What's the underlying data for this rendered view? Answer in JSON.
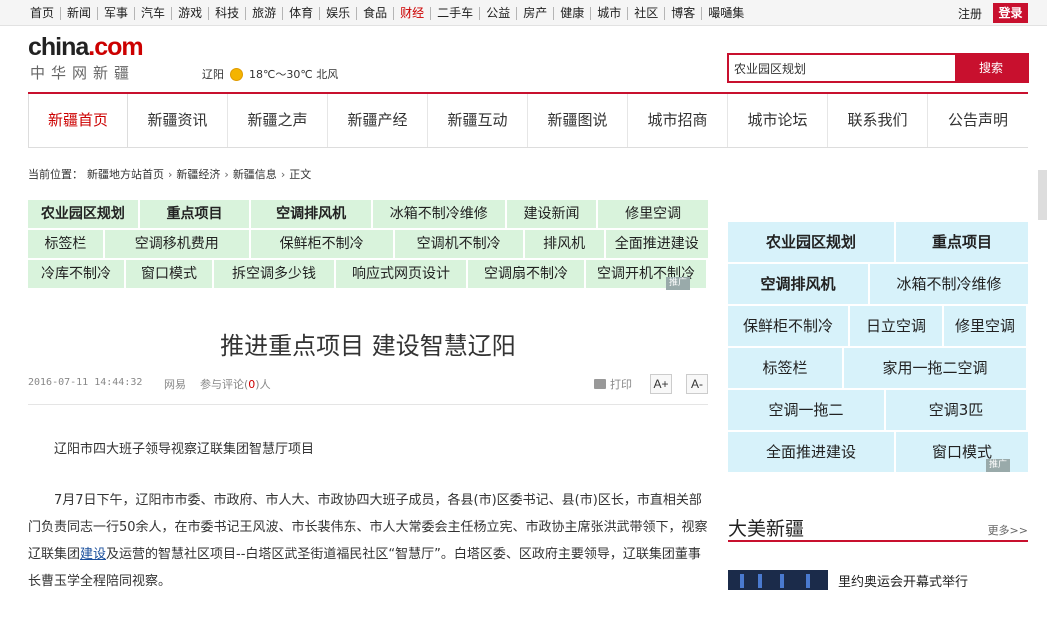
{
  "topnav": [
    "首页",
    "新闻",
    "军事",
    "汽车",
    "游戏",
    "科技",
    "旅游",
    "体育",
    "娱乐",
    "食品",
    "财经",
    "二手车",
    "公益",
    "房产",
    "健康",
    "城市",
    "社区",
    "博客",
    "嘬嗵集"
  ],
  "topnav_active": "财经",
  "register": "注册",
  "login": "登录",
  "logo": {
    "pre": "china",
    "dot": ".com",
    "cn": "中华网新疆"
  },
  "weather": {
    "city": "辽阳",
    "icon": "sun-icon",
    "text": "18℃～30℃ 北风"
  },
  "search": {
    "value": "农业园区规划",
    "button": "搜索"
  },
  "mainnav": [
    "新疆首页",
    "新疆资讯",
    "新疆之声",
    "新疆产经",
    "新疆互动",
    "新疆图说",
    "城市招商",
    "城市论坛",
    "联系我们",
    "公告声明"
  ],
  "breadcrumb": {
    "label": "当前位置：",
    "items": [
      "新疆地方站首页",
      "新疆经济",
      "新疆信息",
      "正文"
    ],
    "sep": "›"
  },
  "tags_left": [
    [
      {
        "t": "农业园区规划",
        "b": true,
        "w": 110
      },
      {
        "t": "重点项目",
        "b": true,
        "w": 110
      },
      {
        "t": "空调排风机",
        "b": true,
        "w": 120
      },
      {
        "t": "冰箱不制冷维修",
        "w": 132
      },
      {
        "t": "建设新闻",
        "w": 90
      },
      {
        "t": "修里空调",
        "w": 110
      }
    ],
    [
      {
        "t": "标签栏",
        "w": 76
      },
      {
        "t": "空调移机费用",
        "w": 146
      },
      {
        "t": "保鲜柜不制冷",
        "w": 144
      },
      {
        "t": "空调机不制冷",
        "w": 130
      },
      {
        "t": "排风机",
        "w": 80
      },
      {
        "t": "全面推进建设",
        "w": 104
      }
    ],
    [
      {
        "t": "冷库不制冷",
        "w": 96
      },
      {
        "t": "窗口模式",
        "w": 86
      },
      {
        "t": "拆空调多少钱",
        "w": 120
      },
      {
        "t": "响应式网页设计",
        "w": 130
      },
      {
        "t": "空调扇不制冷",
        "w": 116
      },
      {
        "t": "空调开机不制冷",
        "w": 120
      }
    ]
  ],
  "tags_right": [
    [
      {
        "t": "农业园区规划",
        "b": true,
        "w": 166
      },
      {
        "t": "重点项目",
        "b": true,
        "w": 132
      }
    ],
    [
      {
        "t": "空调排风机",
        "b": true,
        "w": 140
      },
      {
        "t": "冰箱不制冷维修",
        "w": 158
      }
    ],
    [
      {
        "t": "保鲜柜不制冷",
        "w": 120
      },
      {
        "t": "日立空调",
        "w": 92
      },
      {
        "t": "修里空调",
        "w": 82
      }
    ],
    [
      {
        "t": "标签栏",
        "w": 114
      },
      {
        "t": "家用一拖二空调",
        "w": 182
      }
    ],
    [
      {
        "t": "空调一拖二",
        "w": 156
      },
      {
        "t": "空调3匹",
        "w": 140
      }
    ],
    [
      {
        "t": "全面推进建设",
        "w": 166
      },
      {
        "t": "窗口模式",
        "w": 132
      }
    ]
  ],
  "ad_label": "推广",
  "article": {
    "title": "推进重点项目 建设智慧辽阳",
    "date": "2016-07-11 14:44:32",
    "source": "网易",
    "comment_prefix": "参与评论",
    "comment_count": "0",
    "comment_suffix": "人",
    "print": "打印",
    "font_up": "A+",
    "font_down": "A-",
    "p1": "辽阳市四大班子领导视察辽联集团智慧厅项目",
    "p2a": "7月7日下午，辽阳市市委、市政府、市人大、市政协四大班子成员，各县(市)区委书记、县(市)区长，市直相关部门负责同志一行50余人，在市委书记王风波、市长裴伟东、市人大常委会主任杨立宪、市政协主席张洪武带领下，视察辽联集团",
    "p2link": "建设",
    "p2b": "及运营的智慧社区项目--白塔区武圣街道福民社区“智慧厅”。白塔区委、区政府主要领导，辽联集团董事长曹玉学全程陪同视察。"
  },
  "section": {
    "title": "大美新疆",
    "more": "更多>>"
  },
  "news": [
    {
      "title": "里约奥运会开幕式举行"
    }
  ]
}
